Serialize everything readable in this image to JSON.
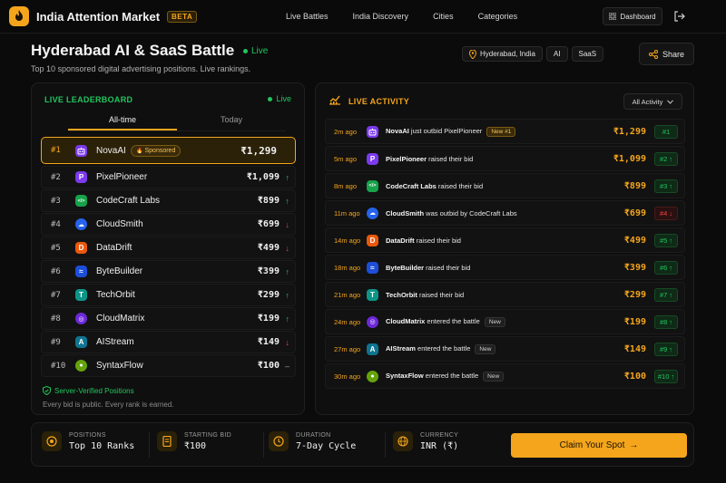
{
  "app": {
    "name": "India Attention Market",
    "beta": "BETA"
  },
  "nav": [
    "Live Battles",
    "India Discovery",
    "Cities",
    "Categories"
  ],
  "dashboard_label": "Dashboard",
  "page": {
    "title": "Hyderabad AI & SaaS Battle",
    "live_label": "Live",
    "subtitle": "Top 10 sponsored digital advertising positions. Live rankings.",
    "tags": [
      "Hyderabad, India",
      "AI",
      "SaaS"
    ],
    "share_label": "Share"
  },
  "leaderboard": {
    "title": "LIVE LEADERBOARD",
    "live_label": "Live",
    "tabs": [
      "All-time",
      "Today"
    ],
    "sponsored_label": "Sponsored",
    "rows": [
      {
        "rank": "#1",
        "name": "NovaAI",
        "bid": "₹1,299",
        "trend": "",
        "icon_letter": "",
        "color": "#7c3aed"
      },
      {
        "rank": "#2",
        "name": "PixelPioneer",
        "bid": "₹1,099",
        "trend": "↑",
        "icon_letter": "P",
        "color": "#7c3aed"
      },
      {
        "rank": "#3",
        "name": "CodeCraft Labs",
        "bid": "₹899",
        "trend": "↑",
        "icon_letter": "</>",
        "color": "#16a34a"
      },
      {
        "rank": "#4",
        "name": "CloudSmith",
        "bid": "₹699",
        "trend": "↓",
        "icon_letter": "☁",
        "color": "#2563eb"
      },
      {
        "rank": "#5",
        "name": "DataDrift",
        "bid": "₹499",
        "trend": "↓",
        "icon_letter": "D",
        "color": "#ea580c"
      },
      {
        "rank": "#6",
        "name": "ByteBuilder",
        "bid": "₹399",
        "trend": "↑",
        "icon_letter": "≈",
        "color": "#1d4ed8"
      },
      {
        "rank": "#7",
        "name": "TechOrbit",
        "bid": "₹299",
        "trend": "↑",
        "icon_letter": "T",
        "color": "#0d9488"
      },
      {
        "rank": "#8",
        "name": "CloudMatrix",
        "bid": "₹199",
        "trend": "↑",
        "icon_letter": "◎",
        "color": "#6d28d9"
      },
      {
        "rank": "#9",
        "name": "AIStream",
        "bid": "₹149",
        "trend": "↓",
        "icon_letter": "A",
        "color": "#0e7490"
      },
      {
        "rank": "#10",
        "name": "SyntaxFlow",
        "bid": "₹100",
        "trend": "–",
        "icon_letter": "●",
        "color": "#65a30d"
      }
    ],
    "verified": "Server-Verified Positions",
    "every_bid": "Every bid is public. Every rank is earned."
  },
  "activity": {
    "title": "LIVE ACTIVITY",
    "filter": "All Activity",
    "rows": [
      {
        "time": "2m ago",
        "name": "NovaAI",
        "text": " just outbid PixelPioneer",
        "badge": "New #1",
        "badge_kind": "gold",
        "amount": "₹1,299",
        "rank": "#1",
        "dir": "",
        "chip": "g",
        "icon_letter": "",
        "color": "#7c3aed"
      },
      {
        "time": "5m ago",
        "name": "PixelPioneer",
        "text": " raised their bid",
        "badge": "",
        "badge_kind": "",
        "amount": "₹1,099",
        "rank": "#2",
        "dir": "↑",
        "chip": "g",
        "icon_letter": "P",
        "color": "#7c3aed"
      },
      {
        "time": "8m ago",
        "name": "CodeCraft Labs",
        "text": " raised their bid",
        "badge": "",
        "badge_kind": "",
        "amount": "₹899",
        "rank": "#3",
        "dir": "↑",
        "chip": "g",
        "icon_letter": "</>",
        "color": "#16a34a"
      },
      {
        "time": "11m ago",
        "name": "CloudSmith",
        "text": " was outbid by CodeCraft Labs",
        "badge": "",
        "badge_kind": "",
        "amount": "₹699",
        "rank": "#4",
        "dir": "↓",
        "chip": "r",
        "icon_letter": "☁",
        "color": "#2563eb"
      },
      {
        "time": "14m ago",
        "name": "DataDrift",
        "text": " raised their bid",
        "badge": "",
        "badge_kind": "",
        "amount": "₹499",
        "rank": "#5",
        "dir": "↑",
        "chip": "g",
        "icon_letter": "D",
        "color": "#ea580c"
      },
      {
        "time": "18m ago",
        "name": "ByteBuilder",
        "text": " raised their bid",
        "badge": "",
        "badge_kind": "",
        "amount": "₹399",
        "rank": "#6",
        "dir": "↑",
        "chip": "g",
        "icon_letter": "≈",
        "color": "#1d4ed8"
      },
      {
        "time": "21m ago",
        "name": "TechOrbit",
        "text": " raised their bid",
        "badge": "",
        "badge_kind": "",
        "amount": "₹299",
        "rank": "#7",
        "dir": "↑",
        "chip": "g",
        "icon_letter": "T",
        "color": "#0d9488"
      },
      {
        "time": "24m ago",
        "name": "CloudMatrix",
        "text": " entered the battle",
        "badge": "New",
        "badge_kind": "gray",
        "amount": "₹199",
        "rank": "#8",
        "dir": "↑",
        "chip": "g",
        "icon_letter": "◎",
        "color": "#6d28d9"
      },
      {
        "time": "27m ago",
        "name": "AIStream",
        "text": " entered the battle",
        "badge": "New",
        "badge_kind": "gray",
        "amount": "₹149",
        "rank": "#9",
        "dir": "↑",
        "chip": "g",
        "icon_letter": "A",
        "color": "#0e7490"
      },
      {
        "time": "30m ago",
        "name": "SyntaxFlow",
        "text": " entered the battle",
        "badge": "New",
        "badge_kind": "gray",
        "amount": "₹100",
        "rank": "#10",
        "dir": "↑",
        "chip": "g",
        "icon_letter": "●",
        "color": "#65a30d"
      }
    ]
  },
  "footer": {
    "stats": [
      {
        "label": "POSITIONS",
        "value": "Top 10 Ranks"
      },
      {
        "label": "STARTING BID",
        "value": "₹100"
      },
      {
        "label": "DURATION",
        "value": "7-Day Cycle"
      },
      {
        "label": "CURRENCY",
        "value": "INR (₹)"
      }
    ],
    "cta": "Claim Your Spot"
  },
  "colors": {
    "accent": "#f4a51c",
    "live": "#22c55e",
    "down": "#ef4444"
  }
}
